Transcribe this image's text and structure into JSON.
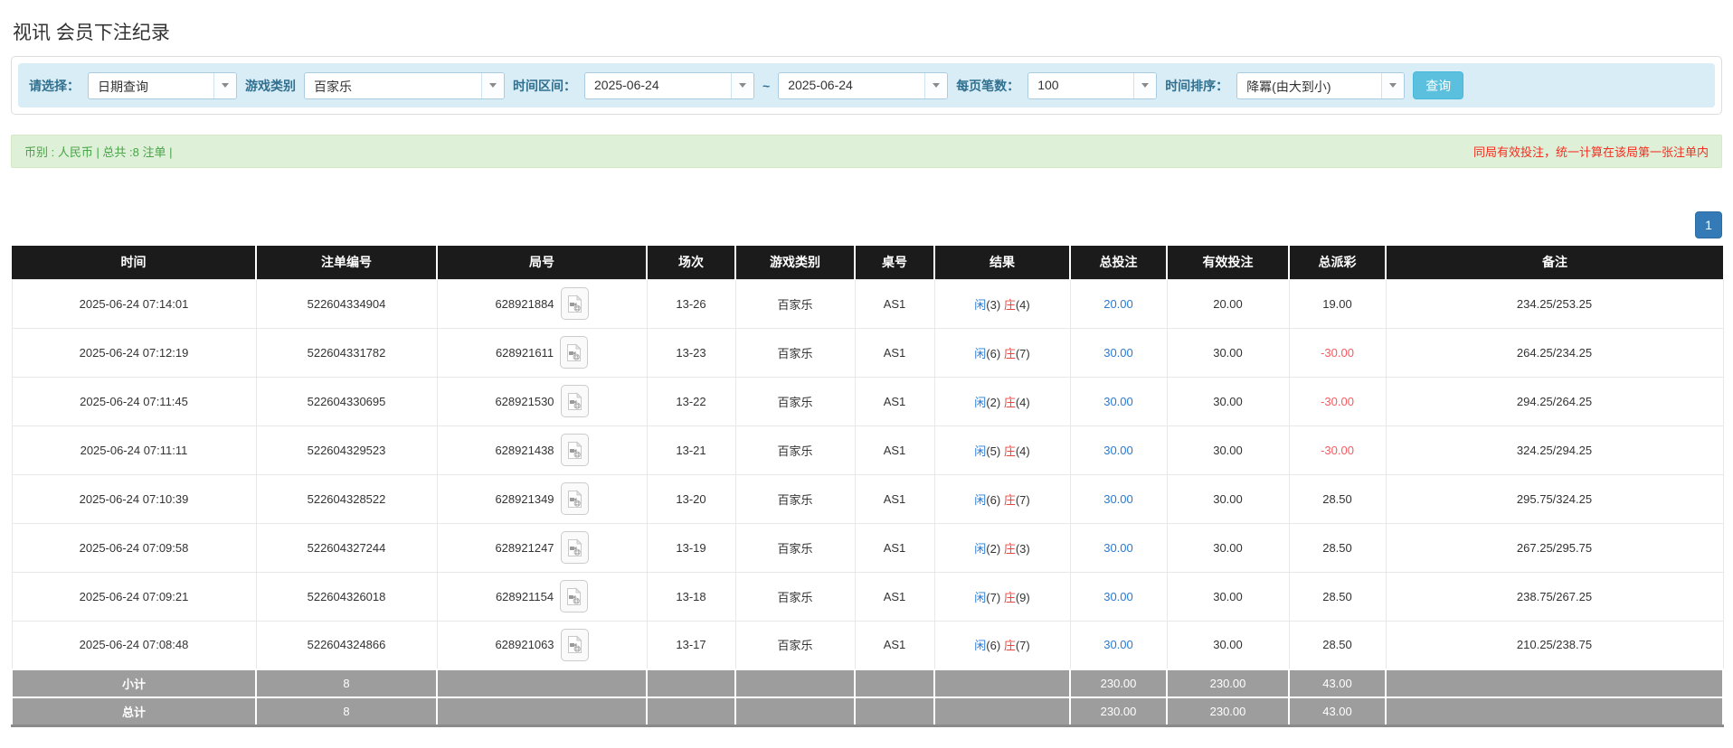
{
  "page": {
    "title": "视讯 会员下注纪录"
  },
  "filters": {
    "select_label": "请选择：",
    "select_value": "日期查询",
    "game_type_label": "游戏类别",
    "game_type_value": "百家乐",
    "date_range_label": "时间区间：",
    "date_from": "2025-06-24",
    "date_tilde": "~",
    "date_to": "2025-06-24",
    "page_size_label": "每页笔数：",
    "page_size_value": "100",
    "sort_label": "时间排序：",
    "sort_value": "降冪(由大到小)",
    "search_button": "查询"
  },
  "summary": {
    "left": "币别 : 人民币 | 总共 :8 注单 |",
    "right_note": "同局有效投注，统一计算在该局第一张注单内"
  },
  "pagination": {
    "current": "1"
  },
  "table": {
    "headers": [
      "时间",
      "注单编号",
      "局号",
      "场次",
      "游戏类别",
      "桌号",
      "结果",
      "总投注",
      "有效投注",
      "总派彩",
      "备注"
    ],
    "result_labels": {
      "player": "闲",
      "banker": "庄"
    },
    "rows": [
      {
        "time": "2025-06-24 07:14:01",
        "bet_id": "522604334904",
        "round_id": "628921884",
        "session": "13-26",
        "game": "百家乐",
        "table_no": "AS1",
        "player": "(3)",
        "banker": "(4)",
        "total_bet": "20.00",
        "valid_bet": "20.00",
        "payout": "19.00",
        "remark": "234.25/253.25"
      },
      {
        "time": "2025-06-24 07:12:19",
        "bet_id": "522604331782",
        "round_id": "628921611",
        "session": "13-23",
        "game": "百家乐",
        "table_no": "AS1",
        "player": "(6)",
        "banker": "(7)",
        "total_bet": "30.00",
        "valid_bet": "30.00",
        "payout": "-30.00",
        "remark": "264.25/234.25"
      },
      {
        "time": "2025-06-24 07:11:45",
        "bet_id": "522604330695",
        "round_id": "628921530",
        "session": "13-22",
        "game": "百家乐",
        "table_no": "AS1",
        "player": "(2)",
        "banker": "(4)",
        "total_bet": "30.00",
        "valid_bet": "30.00",
        "payout": "-30.00",
        "remark": "294.25/264.25"
      },
      {
        "time": "2025-06-24 07:11:11",
        "bet_id": "522604329523",
        "round_id": "628921438",
        "session": "13-21",
        "game": "百家乐",
        "table_no": "AS1",
        "player": "(5)",
        "banker": "(4)",
        "total_bet": "30.00",
        "valid_bet": "30.00",
        "payout": "-30.00",
        "remark": "324.25/294.25"
      },
      {
        "time": "2025-06-24 07:10:39",
        "bet_id": "522604328522",
        "round_id": "628921349",
        "session": "13-20",
        "game": "百家乐",
        "table_no": "AS1",
        "player": "(6)",
        "banker": "(7)",
        "total_bet": "30.00",
        "valid_bet": "30.00",
        "payout": "28.50",
        "remark": "295.75/324.25"
      },
      {
        "time": "2025-06-24 07:09:58",
        "bet_id": "522604327244",
        "round_id": "628921247",
        "session": "13-19",
        "game": "百家乐",
        "table_no": "AS1",
        "player": "(2)",
        "banker": "(3)",
        "total_bet": "30.00",
        "valid_bet": "30.00",
        "payout": "28.50",
        "remark": "267.25/295.75"
      },
      {
        "time": "2025-06-24 07:09:21",
        "bet_id": "522604326018",
        "round_id": "628921154",
        "session": "13-18",
        "game": "百家乐",
        "table_no": "AS1",
        "player": "(7)",
        "banker": "(9)",
        "total_bet": "30.00",
        "valid_bet": "30.00",
        "payout": "28.50",
        "remark": "238.75/267.25"
      },
      {
        "time": "2025-06-24 07:08:48",
        "bet_id": "522604324866",
        "round_id": "628921063",
        "session": "13-17",
        "game": "百家乐",
        "table_no": "AS1",
        "player": "(6)",
        "banker": "(7)",
        "total_bet": "30.00",
        "valid_bet": "30.00",
        "payout": "28.50",
        "remark": "210.25/238.75"
      }
    ],
    "subtotal": {
      "label": "小计",
      "count": "8",
      "total_bet": "230.00",
      "valid_bet": "230.00",
      "payout": "43.00"
    },
    "total": {
      "label": "总计",
      "count": "8",
      "total_bet": "230.00",
      "valid_bet": "230.00",
      "payout": "43.00"
    }
  },
  "colors": {
    "filter_bg": "#d9edf7",
    "filter_label": "#31708f",
    "search_button_bg": "#5bc0de",
    "summary_bg": "#dff0d8",
    "summary_text_green": "#47a447",
    "note_red": "#f42e21",
    "pagination_blue": "#337ab7",
    "header_bg": "#1b1b1b",
    "footer_bg": "#9d9d9d",
    "link_blue": "#2a7ad2",
    "player_blue": "#2a7ad2",
    "banker_red": "#e8453c",
    "negative_red": "#fa5a5f"
  }
}
